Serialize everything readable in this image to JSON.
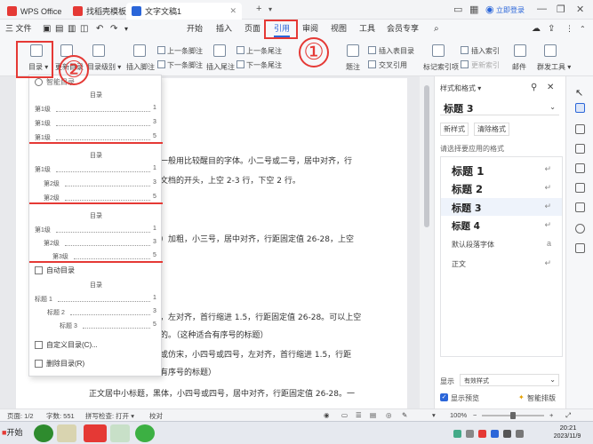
{
  "titlebar": {
    "tabs": [
      {
        "label": "WPS Office",
        "icon": "wps-logo-icon"
      },
      {
        "label": "找稻壳模板",
        "icon": "docer-icon"
      },
      {
        "label": "文字文稿1",
        "icon": "writer-doc-icon"
      }
    ],
    "login": "立即登录"
  },
  "menubar": {
    "file": "三 文件",
    "items": [
      "开始",
      "插入",
      "页面",
      "引用",
      "审阅",
      "视图",
      "工具",
      "会员专享"
    ],
    "active": "引用"
  },
  "ribbon": {
    "toc_label": "目录",
    "update_toc": "更新目录",
    "toc_level": "目录级别",
    "insert_footnote": "插入脚注",
    "prev_footnote": "上一条脚注",
    "next_footnote": "下一条脚注",
    "insert_endnote": "插入尾注",
    "prev_endnote": "上一条尾注",
    "next_endnote": "下一条尾注",
    "caption": "题注",
    "insert_table_of_figures": "插入表目录",
    "cross_reference": "交叉引用",
    "mark_index": "标记索引项",
    "insert_index": "插入索引",
    "update_index": "更新索引",
    "mail": "邮件",
    "doc_tools": "群发工具"
  },
  "annotations": {
    "one": "①",
    "two": "②"
  },
  "toc_dropdown": {
    "smart_toc": "智能目录",
    "template1": {
      "heading": "目录",
      "rows": [
        {
          "label": "第1级",
          "page": "1"
        },
        {
          "label": "第1级",
          "page": "3"
        },
        {
          "label": "第1级",
          "page": "5"
        }
      ]
    },
    "template2": {
      "heading": "目录",
      "rows": [
        {
          "label": "第1级",
          "page": "1"
        },
        {
          "label": "第2级",
          "page": "3"
        },
        {
          "label": "第2级",
          "page": "5"
        }
      ]
    },
    "template3": {
      "heading": "目录",
      "rows": [
        {
          "label": "第1级",
          "page": "1"
        },
        {
          "label": "第2级",
          "page": "3"
        },
        {
          "label": "第3级",
          "page": "5"
        }
      ]
    },
    "auto_toc": "自动目录",
    "template4": {
      "heading": "目录",
      "rows": [
        {
          "label": "标题 1",
          "page": "1"
        },
        {
          "label": "标题 2",
          "page": "3"
        },
        {
          "label": "标题 3",
          "page": "5"
        }
      ]
    },
    "custom_toc": "自定义目录(C)...",
    "delete_toc": "删除目录(R)"
  },
  "document": {
    "lines": [
      "一般用比较醒目的字体。小二号或二号，居中对齐，行",
      "文档的开头，上空 2-3 行，下空 2 行。",
      "）加粗，小三号，居中对齐，行距固定值 26-28，上空",
      "，左对齐，首行缩进 1.5，行距固定值 26-28。可以上空",
      "的。（这种适合有序号的标题）",
      "或仿宋，小四号或四号，左对齐，首行缩进 1.5，行距",
      "有序号的标题）",
      "正文居中小标题，黑体，小四号或四号，居中对齐，行距固定值 26-28。一"
    ]
  },
  "right_panel": {
    "title": "样式和格式",
    "current_style": "标题 3",
    "new_style": "新样式",
    "clear_format": "清除格式",
    "choose_label": "请选择要应用的格式",
    "styles": [
      "标题 1",
      "标题 2",
      "标题 3",
      "标题 4"
    ],
    "others": [
      "默认段落字体",
      "正文"
    ],
    "show_label": "显示",
    "show_value": "有效样式",
    "preview_label": "显示预览",
    "smart_format": "智能排版"
  },
  "statusbar": {
    "page": "页面: 1/2",
    "words": "字数: 551",
    "spell": "拼写检查: 打开",
    "proof": "校对",
    "zoom": "100%"
  },
  "taskbar": {
    "start": "开始",
    "time": "20:21",
    "date": "2023/11/9"
  },
  "colors": {
    "accent": "#2b66d9",
    "annotation_red": "#e53935"
  }
}
